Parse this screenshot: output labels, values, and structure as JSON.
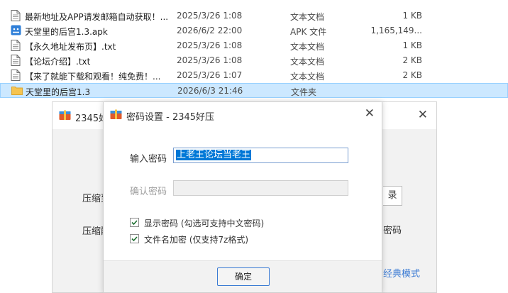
{
  "files": [
    {
      "name": "最新地址及APP请发邮箱自动获取！...",
      "date": "2025/3/26 1:08",
      "type": "文本文档",
      "size": "1 KB",
      "icon": "text-file-icon"
    },
    {
      "name": "天堂里的后宫1.3.apk",
      "date": "2026/6/2 22:00",
      "type": "APK 文件",
      "size": "1,165,149...",
      "icon": "apk-file-icon"
    },
    {
      "name": "【永久地址发布页】.txt",
      "date": "2025/3/26 1:08",
      "type": "文本文档",
      "size": "1 KB",
      "icon": "text-file-icon"
    },
    {
      "name": "【论坛介绍】.txt",
      "date": "2025/3/26 1:08",
      "type": "文本文档",
      "size": "2 KB",
      "icon": "text-file-icon"
    },
    {
      "name": "【来了就能下载和观看！纯免费！...",
      "date": "2025/3/26 1:07",
      "type": "文本文档",
      "size": "2 KB",
      "icon": "text-file-icon"
    },
    {
      "name": "天堂里的后宫1.3",
      "date": "2026/6/3 21:46",
      "type": "文件夹",
      "size": "",
      "icon": "folder-icon",
      "selected": true
    }
  ],
  "back_dialog": {
    "title": "2345好压",
    "label_1": "压缩到",
    "label_2": "压缩配",
    "button_fragment": "录",
    "text_fragment": "密码",
    "link_fragment": "经典模式"
  },
  "password_dialog": {
    "title": "密码设置 - 2345好压",
    "password_label": "输入密码",
    "password_value": "上老王论坛当老王",
    "confirm_label": "确认密码",
    "confirm_value": "",
    "show_password_label": "显示密码 (勾选可支持中文密码)",
    "show_password_checked": true,
    "encrypt_names_label": "文件名加密  (仅支持7z格式)",
    "encrypt_names_checked": true,
    "ok_label": "确定"
  },
  "colors": {
    "selection_bg": "#cce8ff",
    "accent": "#0078d7",
    "link": "#3b7bd4",
    "folder": "#f5c451"
  }
}
